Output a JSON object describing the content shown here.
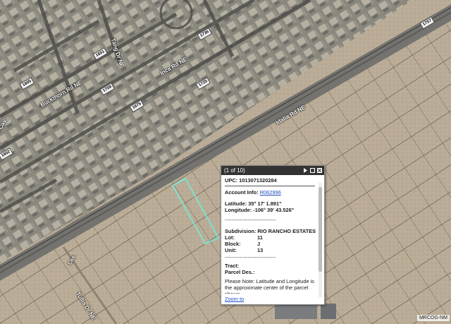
{
  "map": {
    "attribution": "MRCOG-NM",
    "streets": {
      "main_road": "Idalia Rd NE",
      "inca": "Inca Rd NE",
      "buckthorn": "Buckthorn Rd NE",
      "tangerine": "Tang Dr NE",
      "tullis": "Tullis Dr NE",
      "cav": "Cav...",
      "las": "Las"
    },
    "shields": [
      "1605",
      "1736",
      "1757",
      "1725",
      "1651",
      "1602",
      "1709",
      "1675",
      "1561",
      "1580",
      "1669"
    ]
  },
  "popup": {
    "counter": "(1 of 10)",
    "upc_label": "UPC:",
    "upc_value": "1013071320284",
    "account_label": "Account Info:",
    "account_value": "R062996",
    "lat_label": "Latitude:",
    "lat_value": "35° 17' 1.891\"",
    "lon_label": "Longitude:",
    "lon_value": "-106° 39' 43.526\"",
    "dashes": "-------------------------------",
    "subdivision_label": "Subdivision:",
    "subdivision_value": "RIO RANCHO ESTATES",
    "lot_label": "Lot:",
    "lot_value": "11",
    "block_label": "Block:",
    "block_value": "J",
    "unit_label": "Unit:",
    "unit_value": "13",
    "tract_label": "Tract:",
    "parcel_label": "Parcel Des.:",
    "note": "Please Note: Latitude and Longitude is the approximate center of the parcel shown.",
    "zoom_link": "Zoom to"
  },
  "colors": {
    "desert": "#b9ab95",
    "residential": "#8f8d84",
    "road": "#6f6e6a",
    "parcel_line": "#3d3527",
    "highlight": "#7fe0d0",
    "header": "#333333",
    "link": "#1f4fbf"
  }
}
